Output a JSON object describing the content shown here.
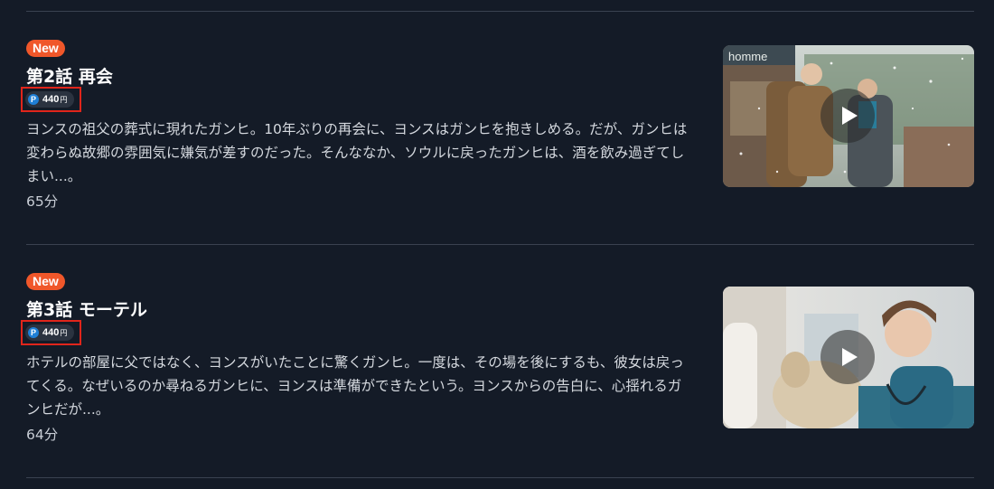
{
  "episodes": [
    {
      "badge": "New",
      "title": "第2話 再会",
      "price": {
        "amount": "440",
        "unit": "円",
        "icon": "P"
      },
      "description": "ヨンスの祖父の葬式に現れたガンヒ。10年ぶりの再会に、ヨンスはガンヒを抱きしめる。だが、ガンヒは変わらぬ故郷の雰囲気に嫌気が差すのだった。そんななか、ソウルに戻ったガンヒは、酒を飲み過ぎてしまい...。",
      "duration": "65分",
      "thumbnail": {
        "icon": "play-icon",
        "sign_text": "homme"
      }
    },
    {
      "badge": "New",
      "title": "第3話 モーテル",
      "price": {
        "amount": "440",
        "unit": "円",
        "icon": "P"
      },
      "description": "ホテルの部屋に父ではなく、ヨンスがいたことに驚くガンヒ。一度は、その場を後にするも、彼女は戻ってくる。なぜいるのか尋ねるガンヒに、ヨンスは準備ができたという。ヨンスからの告白に、心揺れるガンヒだが...。",
      "duration": "64分",
      "thumbnail": {
        "icon": "play-icon"
      }
    }
  ],
  "colors": {
    "background": "#141b27",
    "badge": "#f0572a",
    "highlight_box": "#e0251b",
    "point_icon": "#1f7fd6"
  }
}
